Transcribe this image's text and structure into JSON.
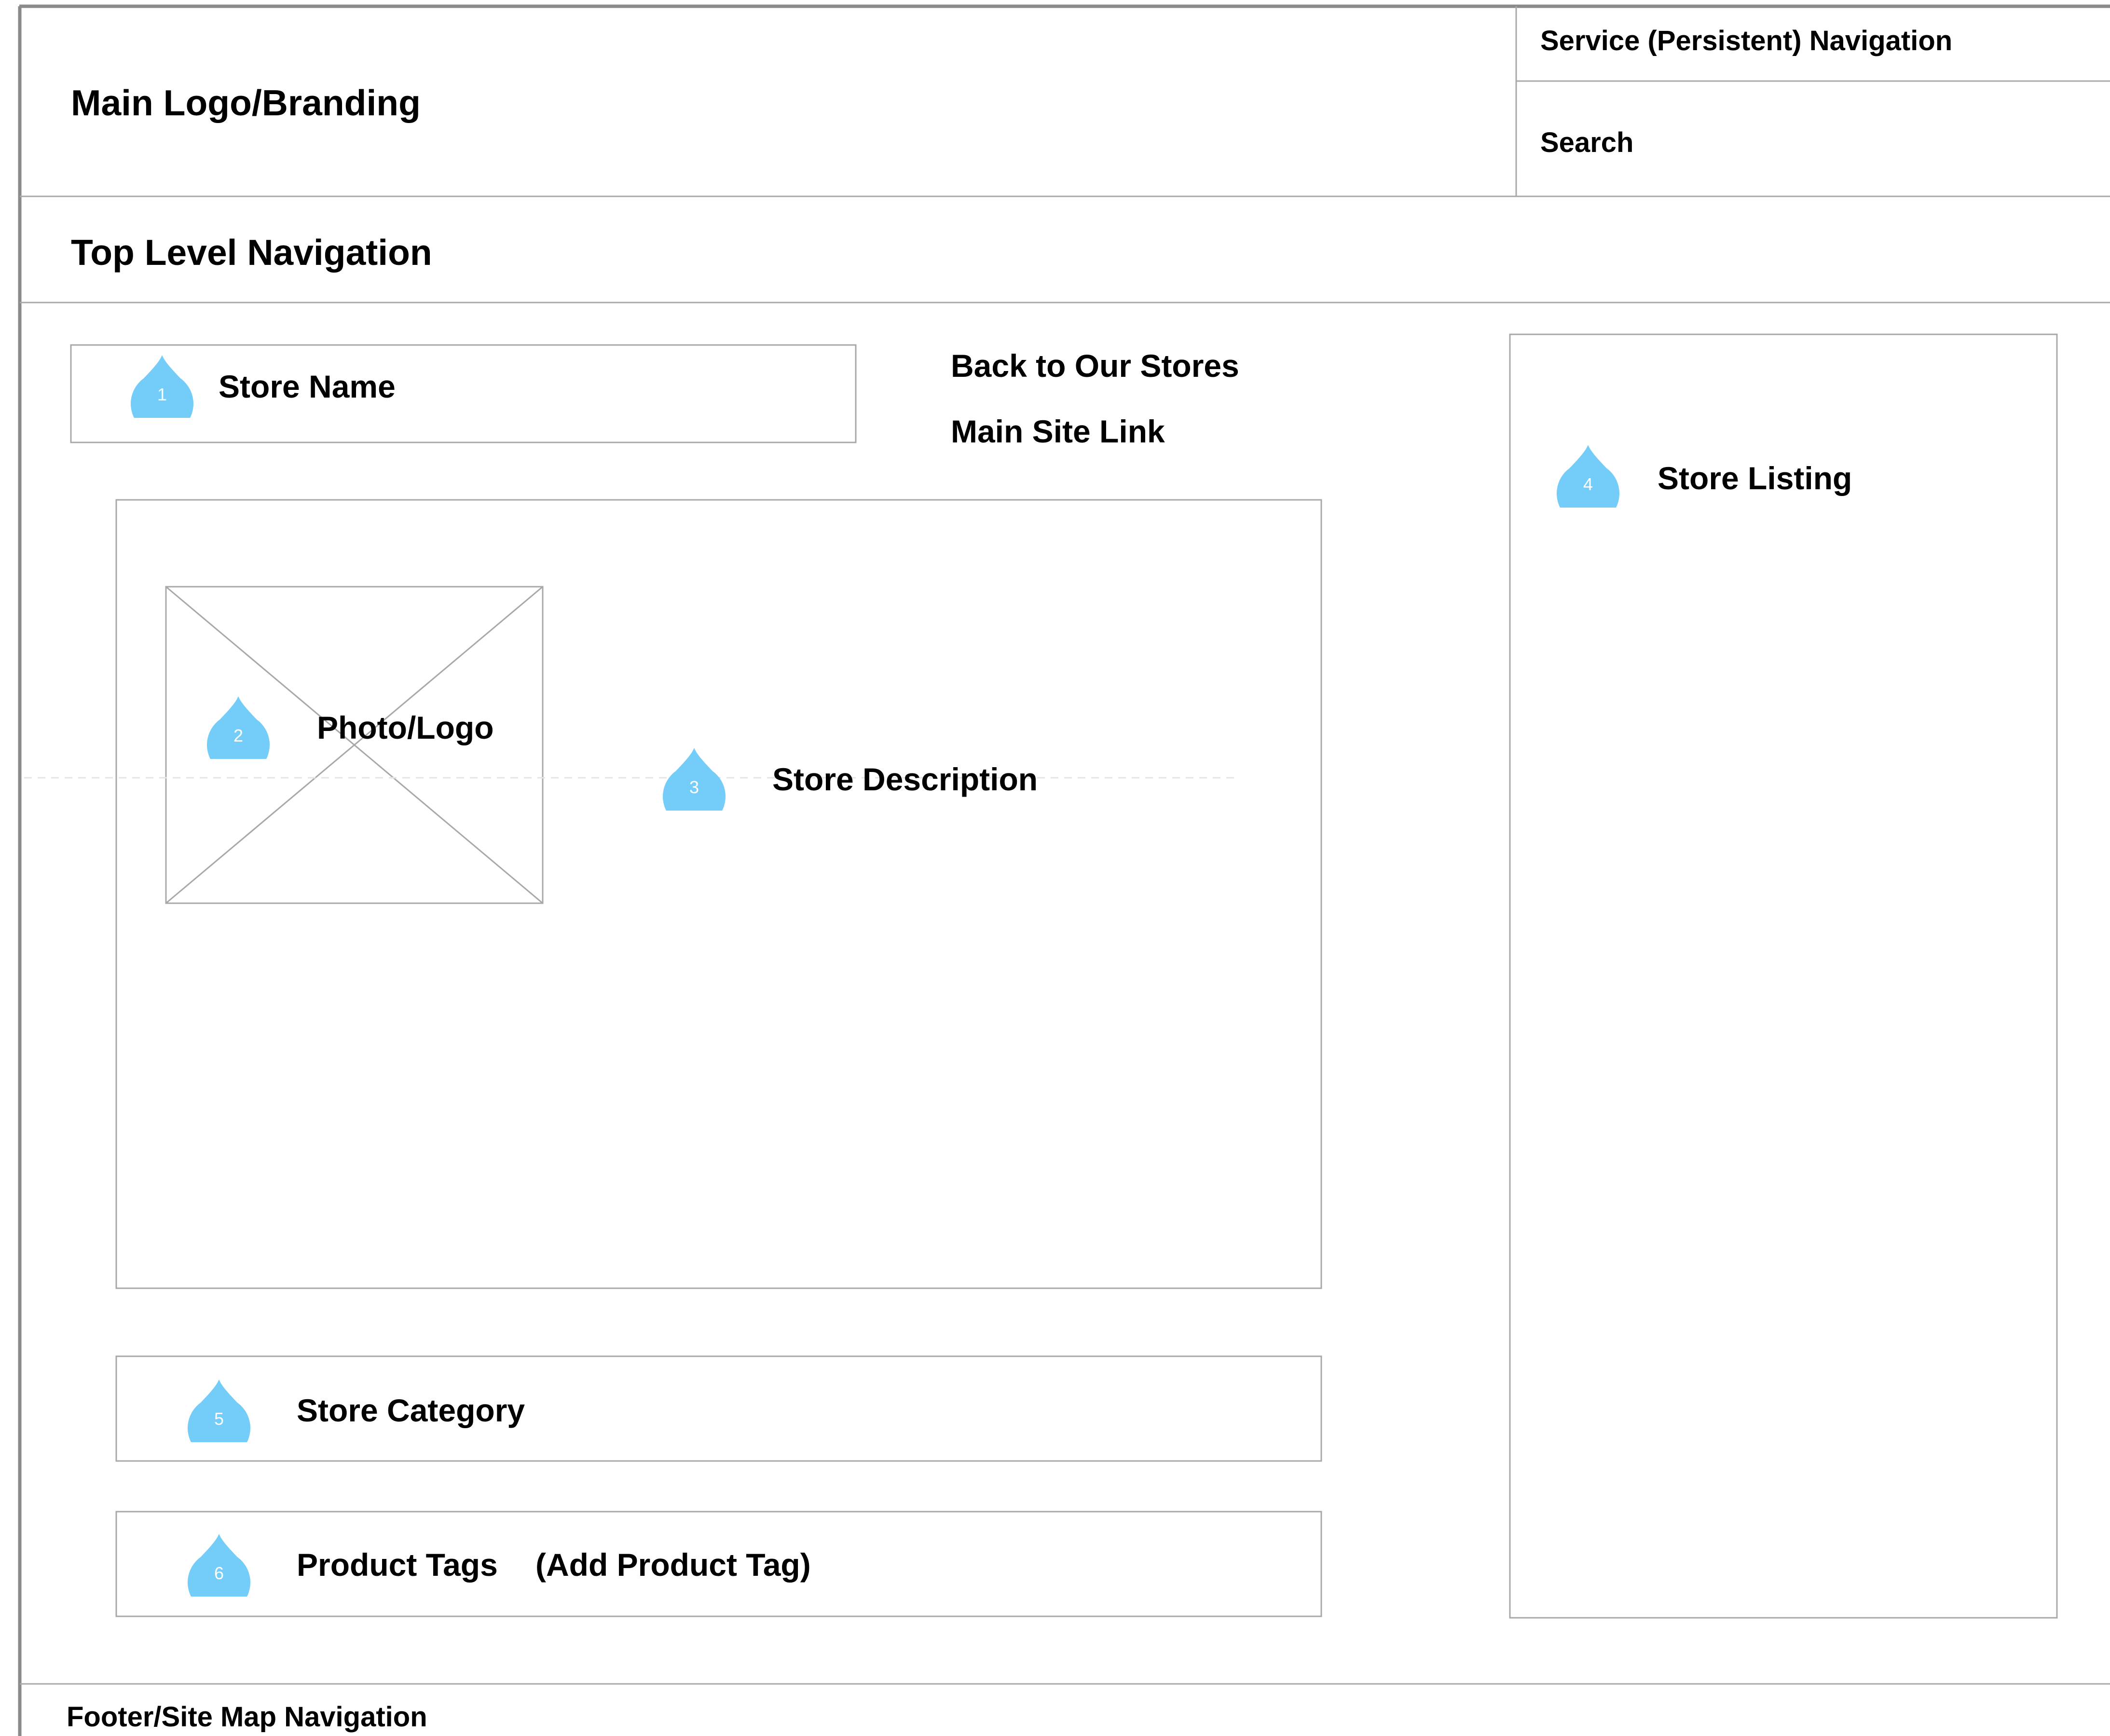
{
  "colors": {
    "marker": "#74cdf8",
    "line": "#a8a8a8",
    "frame": "#8a8a8a"
  },
  "header": {
    "logo": "Main Logo/Branding",
    "service_nav": "Service (Persistent) Navigation",
    "search": "Search"
  },
  "top_nav": "Top Level Navigation",
  "store": {
    "name": "Store Name",
    "back_link": "Back to Our Stores",
    "main_site_link": "Main Site Link",
    "photo": "Photo/Logo",
    "description": "Store Description",
    "listing": "Store Listing",
    "category": "Store Category",
    "product_tags": "Product Tags",
    "add_product_tag": "(Add Product Tag)"
  },
  "markers": [
    "1",
    "2",
    "3",
    "4",
    "5",
    "6"
  ],
  "footer": "Footer/Site Map Navigation"
}
